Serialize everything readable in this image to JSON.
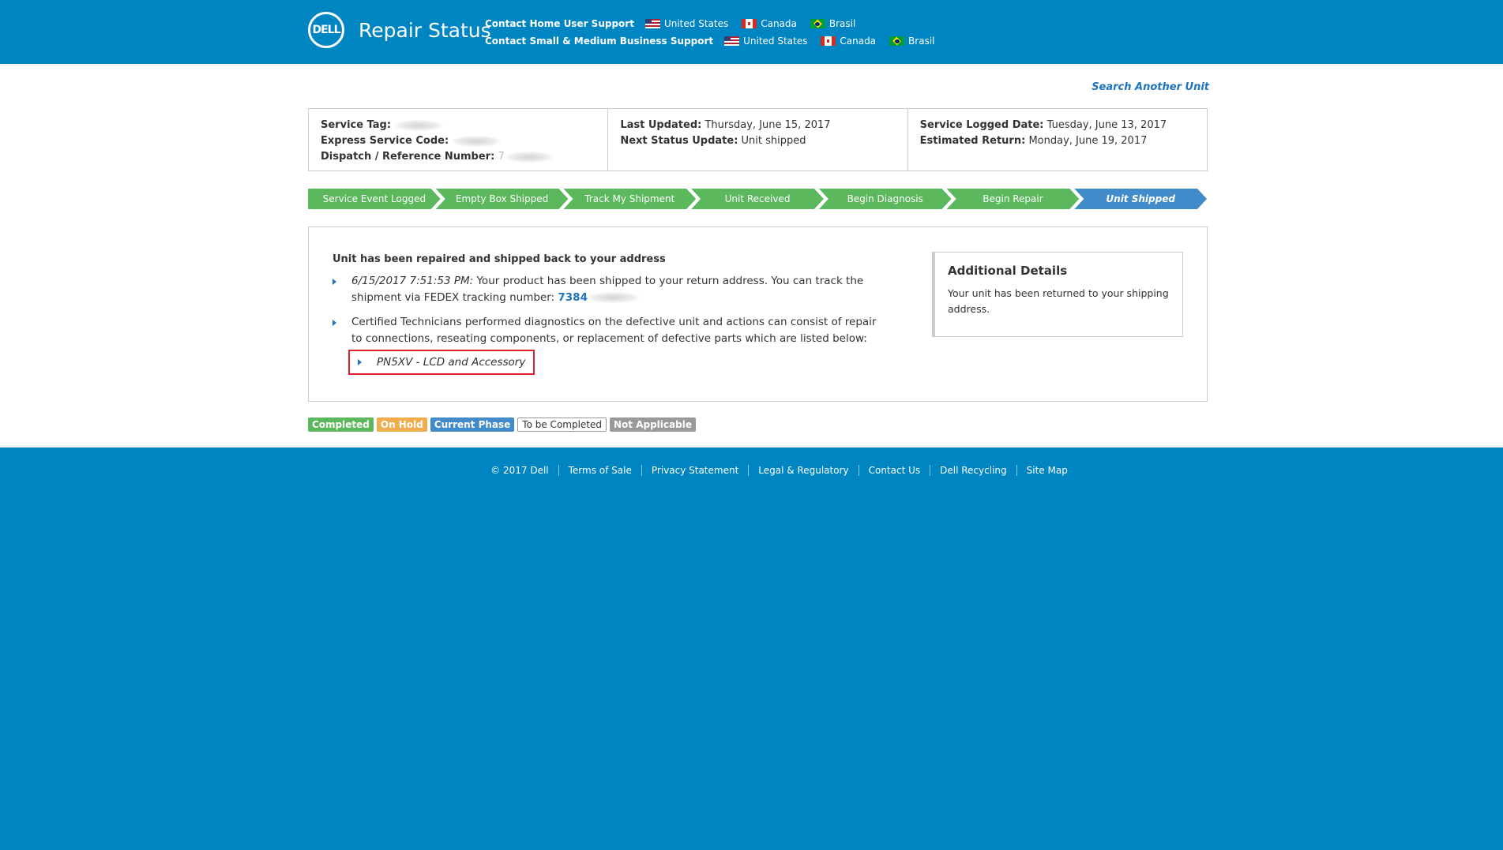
{
  "header": {
    "logo_text": "DELL",
    "title": "Repair Status",
    "support_rows": [
      {
        "label": "Contact Home User Support",
        "countries": [
          {
            "name": "United States",
            "flag": "us"
          },
          {
            "name": "Canada",
            "flag": "ca"
          },
          {
            "name": "Brasil",
            "flag": "br"
          }
        ]
      },
      {
        "label": "Contact Small & Medium Business Support",
        "countries": [
          {
            "name": "United States",
            "flag": "us"
          },
          {
            "name": "Canada",
            "flag": "ca"
          },
          {
            "name": "Brasil",
            "flag": "br"
          }
        ]
      }
    ]
  },
  "search_another": "Search Another Unit",
  "info": {
    "col1": {
      "service_tag_label": "Service Tag:",
      "express_code_label": "Express Service Code:",
      "dispatch_label": "Dispatch / Reference Number:",
      "dispatch_prefix": "7"
    },
    "col2": {
      "last_updated_label": "Last Updated:",
      "last_updated": "Thursday, June 15, 2017",
      "next_status_label": "Next Status Update:",
      "next_status": "Unit shipped"
    },
    "col3": {
      "logged_label": "Service Logged Date:",
      "logged": "Tuesday, June 13, 2017",
      "return_label": "Estimated Return:",
      "return": "Monday, June 19, 2017"
    }
  },
  "steps": [
    {
      "label": "Service Event Logged",
      "state": "completed"
    },
    {
      "label": "Empty Box Shipped",
      "state": "completed"
    },
    {
      "label": "Track My Shipment",
      "state": "completed"
    },
    {
      "label": "Unit Received",
      "state": "completed"
    },
    {
      "label": "Begin Diagnosis",
      "state": "completed"
    },
    {
      "label": "Begin Repair",
      "state": "completed"
    },
    {
      "label": "Unit Shipped",
      "state": "current"
    }
  ],
  "details": {
    "heading": "Unit has been repaired and shipped back to your address",
    "event1_timestamp": "6/15/2017 7:51:53 PM:",
    "event1_text": " Your product has been shipped to your return address. You can track the shipment via FEDEX tracking number: ",
    "tracking_number": "7384",
    "event2_text": "Certified Technicians performed diagnostics on the defective unit and actions can consist of repair to connections, reseating components, or replacement of defective parts which are listed below:",
    "part": "PN5XV - LCD and Accessory",
    "additional_title": "Additional Details",
    "additional_text": "Your unit has been returned to your shipping address."
  },
  "legend": {
    "completed": "Completed",
    "on_hold": "On Hold",
    "current_phase": "Current Phase",
    "to_be_completed": "To be Completed",
    "not_applicable": "Not Applicable"
  },
  "footer": {
    "copyright": "© 2017 Dell",
    "links": [
      "Terms of Sale",
      "Privacy Statement",
      "Legal & Regulatory",
      "Contact Us",
      "Dell Recycling",
      "Site Map"
    ]
  },
  "colors": {
    "brand_blue": "#0085c3",
    "step_complete": "#5cb85c",
    "step_current": "#428bca",
    "highlight_red": "#e0202a"
  }
}
